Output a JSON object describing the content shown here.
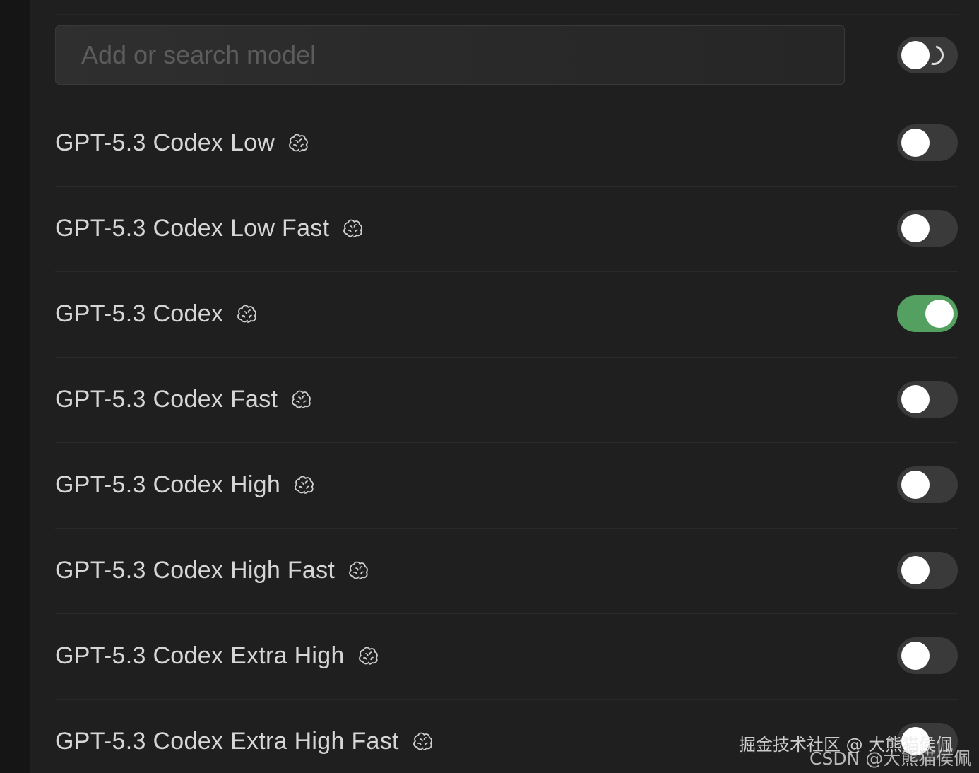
{
  "search": {
    "placeholder": "Add or search model"
  },
  "colors": {
    "background": "#1f1f1f",
    "toggle_off": "#3a3a3a",
    "toggle_on": "#53a061",
    "text": "#d6d6d6"
  },
  "models": [
    {
      "name": "GPT-5.3 Codex Low",
      "icon": "brain-icon",
      "enabled": false
    },
    {
      "name": "GPT-5.3 Codex Low Fast",
      "icon": "brain-icon",
      "enabled": false
    },
    {
      "name": "GPT-5.3 Codex",
      "icon": "brain-icon",
      "enabled": true
    },
    {
      "name": "GPT-5.3 Codex Fast",
      "icon": "brain-icon",
      "enabled": false
    },
    {
      "name": "GPT-5.3 Codex High",
      "icon": "brain-icon",
      "enabled": false
    },
    {
      "name": "GPT-5.3 Codex High Fast",
      "icon": "brain-icon",
      "enabled": false
    },
    {
      "name": "GPT-5.3 Codex Extra High",
      "icon": "brain-icon",
      "enabled": false
    },
    {
      "name": "GPT-5.3 Codex Extra High Fast",
      "icon": "brain-icon",
      "enabled": false
    }
  ],
  "watermarks": {
    "juejin": "掘金技术社区 @ 大熊猫侯佩",
    "csdn": "CSDN @大熊猫侯佩"
  }
}
